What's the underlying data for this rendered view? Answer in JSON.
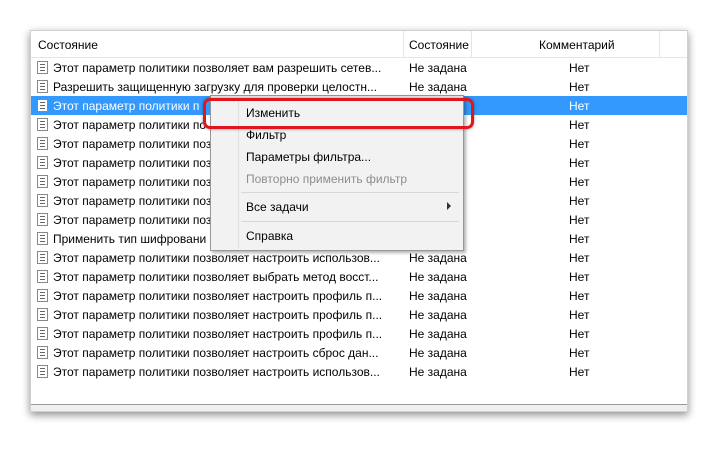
{
  "columns": [
    "Состояние",
    "Состояние",
    "Комментарий"
  ],
  "rows": [
    {
      "name": "Этот параметр политики позволяет вам разрешить сетев...",
      "state": "Не задана",
      "comment": "Нет"
    },
    {
      "name": "Разрешить защищенную загрузку для проверки целостн...",
      "state": "Не задана",
      "comment": "Нет"
    },
    {
      "name": "Этот параметр политики п",
      "state": "",
      "comment": "Нет"
    },
    {
      "name": "Этот параметр политики по",
      "state": "",
      "comment": "Нет"
    },
    {
      "name": "Этот параметр политики поз",
      "state": "",
      "comment": "Нет"
    },
    {
      "name": "Этот параметр политики поз",
      "state": "",
      "comment": "Нет"
    },
    {
      "name": "Этот параметр политики поз",
      "state": "",
      "comment": "Нет"
    },
    {
      "name": "Этот параметр политики поз",
      "state": "",
      "comment": "Нет"
    },
    {
      "name": "Этот параметр политики поз",
      "state": "",
      "comment": "Нет"
    },
    {
      "name": "Применить тип шифровани",
      "state": "",
      "comment": "Нет"
    },
    {
      "name": "Этот параметр политики позволяет настроить использов...",
      "state": "Не задана",
      "comment": "Нет"
    },
    {
      "name": "Этот параметр политики позволяет выбрать метод восст...",
      "state": "Не задана",
      "comment": "Нет"
    },
    {
      "name": "Этот параметр политики позволяет настроить профиль п...",
      "state": "Не задана",
      "comment": "Нет"
    },
    {
      "name": "Этот параметр политики позволяет настроить профиль п...",
      "state": "Не задана",
      "comment": "Нет"
    },
    {
      "name": "Этот параметр политики позволяет настроить профиль п...",
      "state": "Не задана",
      "comment": "Нет"
    },
    {
      "name": "Этот параметр политики позволяет настроить сброс дан...",
      "state": "Не задана",
      "comment": "Нет"
    },
    {
      "name": "Этот параметр политики позволяет настроить использов...",
      "state": "Не задана",
      "comment": "Нет"
    }
  ],
  "menu": {
    "edit": "Изменить",
    "filter": "Фильтр",
    "filter_options": "Параметры фильтра...",
    "reapply": "Повторно применить фильтр",
    "all_tasks": "Все задачи",
    "help": "Справка"
  },
  "colors": {
    "selection": "#3399ff",
    "highlight": "#e0161c"
  }
}
